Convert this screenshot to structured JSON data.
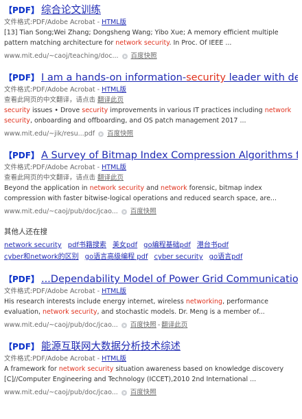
{
  "results": [
    {
      "tag": "【PDF】",
      "title": [
        {
          "t": "综合论文训练",
          "hl": false
        }
      ],
      "meta_prefix": "文件格式:PDF/Adobe Acrobat - ",
      "html_link": "HTML版",
      "translate": "",
      "translate_link": "",
      "snippet": [
        {
          "t": "[13] Tian Song;Wei Zhang; Dongsheng Wang; Yibo Xue; A memory efficient multiple pattern matching architecture for ",
          "hl": false
        },
        {
          "t": "network security",
          "hl": true
        },
        {
          "t": ". In Proc. Of IEEE ...",
          "hl": false
        }
      ],
      "url": "www.mit.edu/~caoj/teaching/doc...",
      "snapshot": "百度快照",
      "extra": ""
    },
    {
      "tag": "【PDF】",
      "title": [
        {
          "t": "I am a hands-on information-",
          "hl": false
        },
        {
          "t": "security",
          "hl": true
        },
        {
          "t": " leader with decad...",
          "hl": false
        }
      ],
      "meta_prefix": "文件格式:PDF/Adobe Acrobat - ",
      "html_link": "HTML版",
      "translate": "查看此网页的中文翻译，请点击 ",
      "translate_link": "翻译此页",
      "snippet": [
        {
          "t": "security",
          "hl": true
        },
        {
          "t": " issues • Drove ",
          "hl": false
        },
        {
          "t": "security",
          "hl": true
        },
        {
          "t": " improvements in various IT practices including ",
          "hl": false
        },
        {
          "t": "network security",
          "hl": true
        },
        {
          "t": ", onboarding and offboarding, and OS patch management 2017 ...",
          "hl": false
        }
      ],
      "url": "www.mit.edu/~jik/resu...pdf",
      "snapshot": "百度快照",
      "extra": ""
    },
    {
      "tag": "【PDF】",
      "title": [
        {
          "t": "A Survey of Bitmap Index Compression Algorithms for Bi...",
          "hl": false
        }
      ],
      "meta_prefix": "文件格式:PDF/Adobe Acrobat - ",
      "html_link": "HTML版",
      "translate": "查看此网页的中文翻译，请点击 ",
      "translate_link": "翻译此页",
      "snippet": [
        {
          "t": "Beyond the application in ",
          "hl": false
        },
        {
          "t": "network security",
          "hl": true
        },
        {
          "t": " and ",
          "hl": false
        },
        {
          "t": "network",
          "hl": true
        },
        {
          "t": " forensic, bitmap index compression with faster bitwise-logical operations and reduced search space, are...",
          "hl": false
        }
      ],
      "url": "www.mit.edu/~caoj/pub/doc/jcao...",
      "snapshot": "百度快照",
      "extra": ""
    }
  ],
  "related": {
    "heading": "其他人还在搜",
    "rows": [
      [
        "network security",
        "pdf书籍搜索",
        "美女pdf",
        "go编程基础pdf",
        "港台书pdf"
      ],
      [
        "cyber和network的区别",
        "go语言高级编程 pdf",
        "cyber security",
        "go语言pdf"
      ]
    ]
  },
  "results2": [
    {
      "tag": "【PDF】",
      "title": [
        {
          "t": "...Dependability Model of Power Grid Communication Net...",
          "hl": false
        }
      ],
      "meta_prefix": "文件格式:PDF/Adobe Acrobat - ",
      "html_link": "HTML版",
      "translate": "",
      "translate_link": "",
      "snippet": [
        {
          "t": "His research interests include energy internet, wireless ",
          "hl": false
        },
        {
          "t": "networking",
          "hl": true
        },
        {
          "t": ", performance evaluation, ",
          "hl": false
        },
        {
          "t": "network security",
          "hl": true
        },
        {
          "t": ", and stochastic models. Dr. Meng is a member of...",
          "hl": false
        }
      ],
      "url": "www.mit.edu/~caoj/pub/doc/jcao...",
      "snapshot": "百度快照",
      "extra": "翻译此页"
    },
    {
      "tag": "【PDF】",
      "title": [
        {
          "t": "能源互联网大数据分析技术综述",
          "hl": false
        }
      ],
      "meta_prefix": "文件格式:PDF/Adobe Acrobat - ",
      "html_link": "HTML版",
      "translate": "",
      "translate_link": "",
      "snippet": [
        {
          "t": "A framework for ",
          "hl": false
        },
        {
          "t": "network security",
          "hl": true
        },
        {
          "t": " situation awareness based on knowledge discovery [C]//Computer Engineering and Technology (ICCET),2010 2nd International ...",
          "hl": false
        }
      ],
      "url": "www.mit.edu/~caoj/pub/doc/jcao...",
      "snapshot": "百度快照",
      "extra": ""
    }
  ],
  "colors": {
    "link": "#1f2ab3",
    "highlight": "#e0321e",
    "tag": "#0b31c9"
  }
}
